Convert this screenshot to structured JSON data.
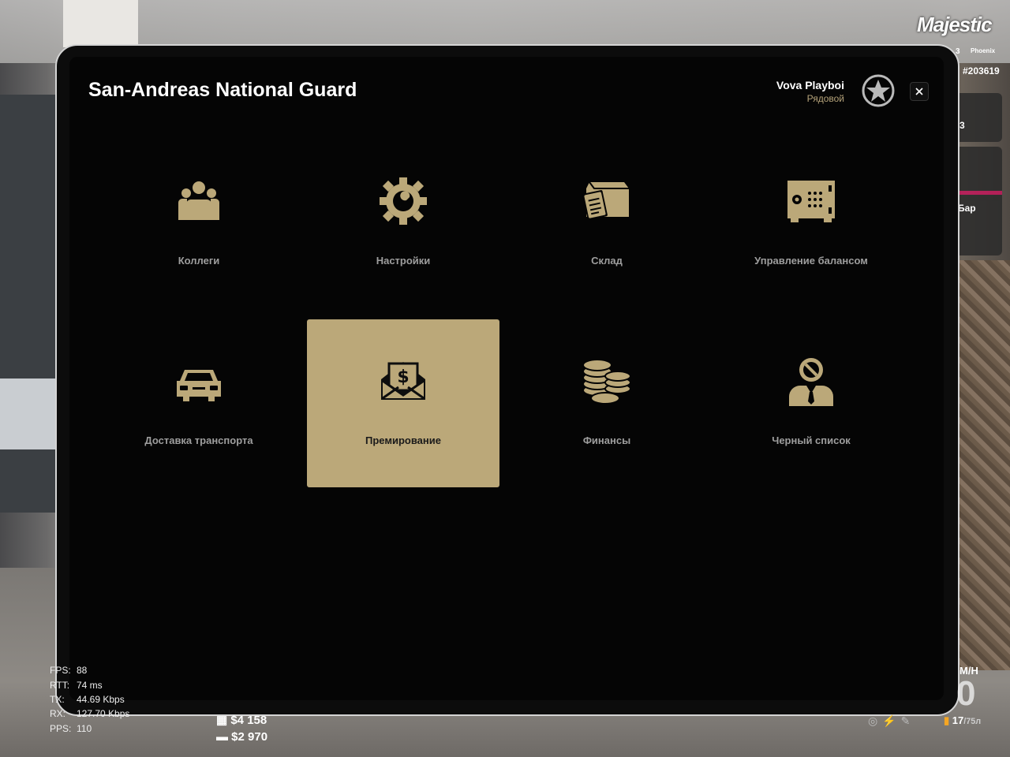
{
  "window": {
    "title": "San-Andreas National Guard"
  },
  "user": {
    "name": "Vova Playboi",
    "rank": "Рядовой",
    "badge_icon": "army-star-icon"
  },
  "close_icon": "close-icon",
  "menu": [
    {
      "label": "Коллеги",
      "icon": "users-group-icon",
      "active": false
    },
    {
      "label": "Настройки",
      "icon": "gear-wrench-icon",
      "active": false
    },
    {
      "label": "Склад",
      "icon": "warehouse-box-icon",
      "active": false
    },
    {
      "label": "Управление балансом",
      "icon": "safe-icon",
      "active": false
    },
    {
      "label": "Доставка транспорта",
      "icon": "car-icon",
      "active": false
    },
    {
      "label": "Премирование",
      "icon": "money-envelope-icon",
      "active": true
    },
    {
      "label": "Финансы",
      "icon": "coins-stack-icon",
      "active": false
    },
    {
      "label": "Черный список",
      "icon": "blacklist-person-icon",
      "active": false
    }
  ],
  "colors": {
    "accent": "#bba879",
    "label": "#9e9e9e",
    "panel": "#050505"
  },
  "hud": {
    "logo": "Majestic",
    "server_num": "3",
    "server_name": "Phoenix",
    "player_id": "#203619",
    "side_a": "3",
    "side_b": "Бар",
    "stats": [
      {
        "key": "FPS:",
        "value": "88"
      },
      {
        "key": "RTT:",
        "value": "74 ms"
      },
      {
        "key": "TX:",
        "value": "44.69 Kbps"
      },
      {
        "key": "RX:",
        "value": "127.70 Kbps"
      },
      {
        "key": "PPS:",
        "value": "110"
      }
    ],
    "money_cash": "$4 158",
    "money_bank": "$2 970",
    "speed_unit": "M/H",
    "speed_value": "0",
    "fuel": "17",
    "fuel_max": "/75л"
  }
}
